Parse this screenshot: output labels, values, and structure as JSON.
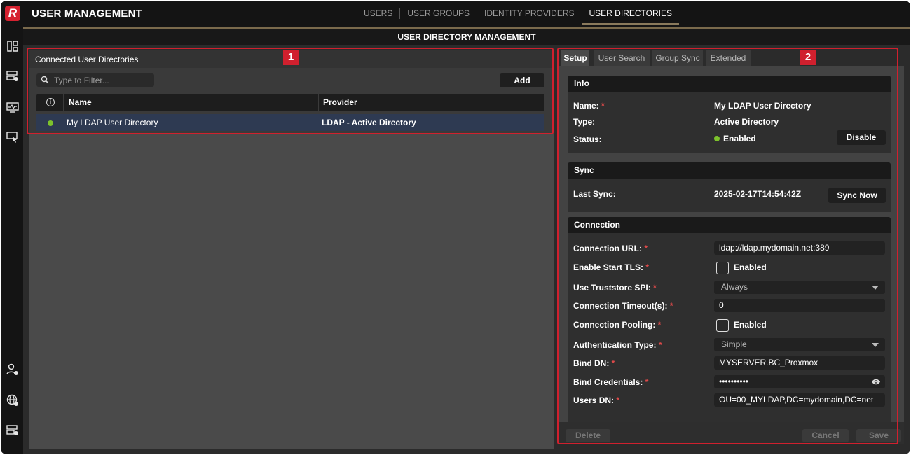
{
  "app": {
    "logo_letter": "R",
    "title": "USER MANAGEMENT"
  },
  "nav_tabs": [
    "USERS",
    "USER GROUPS",
    "IDENTITY PROVIDERS",
    "USER DIRECTORIES"
  ],
  "subheader": "USER DIRECTORY MANAGEMENT",
  "left_panel": {
    "title": "Connected User Directories",
    "filter_placeholder": "Type to Filter...",
    "add_label": "Add",
    "columns": {
      "info": "i",
      "name": "Name",
      "provider": "Provider"
    },
    "rows": [
      {
        "name": "My LDAP User Directory",
        "provider": "LDAP - Active Directory",
        "status_color": "#7dc22c"
      }
    ]
  },
  "badges": {
    "one": "1",
    "two": "2"
  },
  "right_panel": {
    "tabs": [
      "Setup",
      "User Search",
      "Group Sync",
      "Extended"
    ],
    "info": {
      "title": "Info",
      "name_label": "Name:",
      "name_value": "My LDAP User Directory",
      "type_label": "Type:",
      "type_value": "Active Directory",
      "status_label": "Status:",
      "status_value": "Enabled",
      "disable_label": "Disable"
    },
    "sync": {
      "title": "Sync",
      "last_sync_label": "Last Sync:",
      "last_sync_value": "2025-02-17T14:54:42Z",
      "sync_now_label": "Sync Now"
    },
    "connection": {
      "title": "Connection",
      "url_label": "Connection URL:",
      "url_value": "ldap://ldap.mydomain.net:389",
      "tls_label": "Enable Start TLS:",
      "tls_checkbox_label": "Enabled",
      "truststore_label": "Use Truststore SPI:",
      "truststore_value": "Always",
      "timeout_label": "Connection Timeout(s):",
      "timeout_value": "0",
      "pooling_label": "Connection Pooling:",
      "pooling_checkbox_label": "Enabled",
      "auth_label": "Authentication Type:",
      "auth_value": "Simple",
      "bind_dn_label": "Bind DN:",
      "bind_dn_value": "MYSERVER.BC_Proxmox",
      "bind_cred_label": "Bind Credentials:",
      "bind_cred_value": "••••••••••",
      "users_dn_label": "Users DN:",
      "users_dn_value": "OU=00_MYLDAP,DC=mydomain,DC=net"
    },
    "footer": {
      "delete_label": "Delete",
      "cancel_label": "Cancel",
      "save_label": "Save"
    }
  },
  "colors": {
    "accent_red": "#d0202e",
    "status_green": "#7dc22c",
    "selected_row": "#2e3a52"
  }
}
